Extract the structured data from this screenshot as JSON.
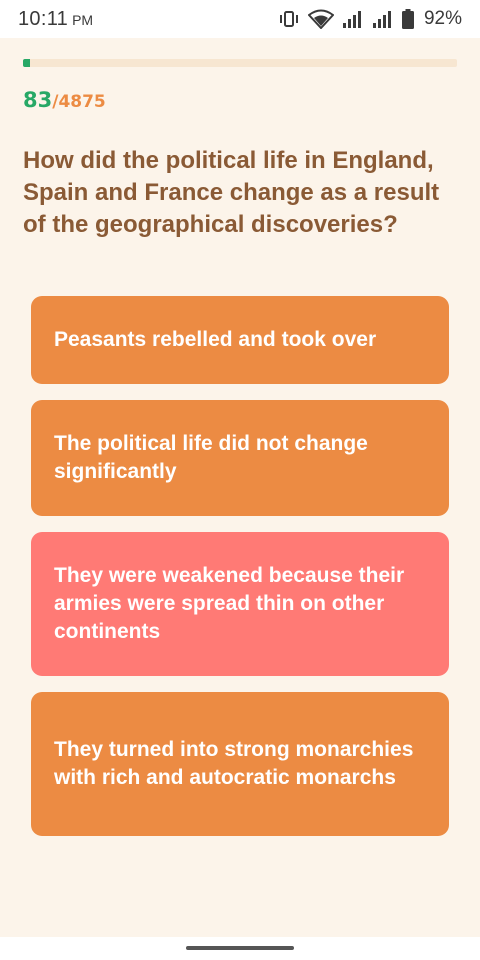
{
  "status_bar": {
    "time": "10:11",
    "ampm": "PM",
    "battery_percent": "92%",
    "icons": [
      "vibrate-icon",
      "wifi-icon",
      "signal-icon",
      "signal-icon",
      "battery-icon"
    ]
  },
  "progress": {
    "current": "83",
    "total": "/4875",
    "fraction": 0.017
  },
  "question": {
    "text": "How did the political life in England, Spain and France change as a result of the geographical discoveries?"
  },
  "answers": [
    {
      "label": "Peasants rebelled and took over",
      "state": "default"
    },
    {
      "label": "The political life did not change significantly",
      "state": "default"
    },
    {
      "label": "They were weakened because their armies were spread thin on other continents",
      "state": "wrong"
    },
    {
      "label": "They turned into strong monarchies with rich and autocratic monarchs",
      "state": "default"
    }
  ],
  "colors": {
    "background": "#fcf4ea",
    "accent_green": "#27a866",
    "accent_orange": "#ec8b43",
    "wrong_red": "#ff7a75",
    "question_brown": "#8a5a35"
  }
}
